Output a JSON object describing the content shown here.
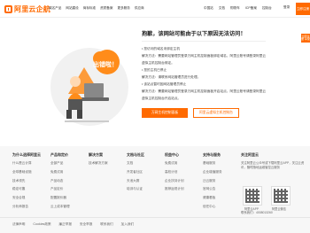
{
  "header": {
    "brand": "阿里云企航",
    "nav": [
      "域名产品",
      "网站建设",
      "商标标准",
      "资质备案",
      "更多服务",
      "供应商"
    ],
    "right_nav": [
      "中国站",
      "文档",
      "购物车",
      "ICP备案",
      "控制台"
    ],
    "login": "登录",
    "register": "立即注册"
  },
  "side_button": "立即注册 享受",
  "error": {
    "illustration_text": "出错啦！",
    "title": "抱歉，该网站可能由于以下原因无法访问！",
    "reasons": [
      "• 您访问的域名未绑定主机",
      "解决方法：需要网站管理员登录万网主机控制面板绑定域名，阿里云账号请登录阿里云",
      "虚拟主机控制台绑定。",
      "• 您的主机已停止",
      "解决方法：请联系网站管理员进行处理。",
      "• 该站点暂时因网站管理员停止",
      "解决方法：需要网站管理员登录万网主机控制面板开启站点，阿里云账号请登录阿里云",
      "虚拟主机控制台开启站点。"
    ],
    "primary_button": "万网主机控制面板",
    "secondary_button": "阿里云虚拟主机控制台"
  },
  "footer": {
    "columns": [
      {
        "heading": "为什么选择阿里云",
        "items": [
          "什么是云计算",
          "全球基础设施",
          "技术领先",
          "稳定可靠",
          "安全合规",
          "分析师报告"
        ]
      },
      {
        "heading": "产品和定价",
        "items": [
          "全部产品",
          "免费试用",
          "产品动态",
          "产品定价",
          "配置报价器",
          "云上成本管理"
        ]
      },
      {
        "heading": "解决方案",
        "items": [
          "技术解决方案"
        ]
      },
      {
        "heading": "文档与社区",
        "items": [
          "文档",
          "开发者社区",
          "天池大赛",
          "培训与认证"
        ]
      },
      {
        "heading": "权益中心",
        "items": [
          "免费试用",
          "高校计划",
          "企业扶持计划",
          "推荐返现计划"
        ]
      },
      {
        "heading": "支持与服务",
        "items": [
          "基础服务",
          "企业增值服务",
          "迁云服务",
          "官网公告",
          "健康看板",
          "信任中心"
        ]
      }
    ],
    "contact": {
      "heading": "关注阿里云",
      "text": "关注阿里云公众号或下载阿里云APP，关注云资讯，随时随地运维管控云服务",
      "qr_captions": [
        "阿里云APP",
        "阿里云微信"
      ],
      "phone": "联系我们：4008013260"
    },
    "links": [
      "法律声明",
      "Cookies政策",
      "廉正举报",
      "安全举报",
      "联系我们",
      "加入我们"
    ]
  }
}
